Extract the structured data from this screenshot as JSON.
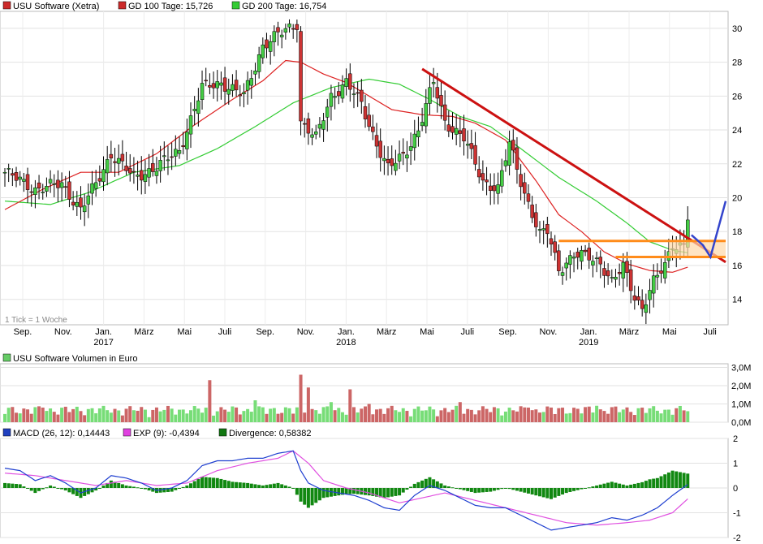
{
  "price_legend": [
    {
      "label": "USU Software (Xetra)",
      "color": "#cc2a2a"
    },
    {
      "label": "GD 100 Tage: 15,726",
      "color": "#cc2a2a"
    },
    {
      "label": "GD 200 Tage: 16,754",
      "color": "#33cc33"
    }
  ],
  "tick_note": "1 Tick = 1 Woche",
  "volume_legend": {
    "label": "USU Software Volumen in Euro",
    "color": "#66cc66"
  },
  "macd_legend": [
    {
      "label": "MACD (26, 12): 0,14443",
      "color": "#1f3fbf"
    },
    {
      "label": "EXP (9): -0,4394",
      "color": "#e040e0"
    },
    {
      "label": "Divergence: 0,58382",
      "color": "#117711"
    }
  ],
  "colors": {
    "up": "#44cc44",
    "down": "#cc3333",
    "ma100": "#dd2222",
    "ma200": "#33cc33",
    "trend": "#cc1111",
    "support": "#ff8c1a",
    "macd": "#2040d0",
    "signal": "#e050e0",
    "hist": "#118811",
    "volup": "#77dd77",
    "voldown": "#cc6666"
  },
  "chart_data": [
    {
      "type": "candlestick",
      "title": "USU Software (Xetra)",
      "y_ticks": [
        "14",
        "16",
        "18",
        "20",
        "22",
        "24",
        "26",
        "28",
        "30"
      ],
      "ylim": [
        12.5,
        31
      ],
      "x_ticks": [
        {
          "label": "Sep.",
          "year": ""
        },
        {
          "label": "Nov.",
          "year": ""
        },
        {
          "label": "Jan.",
          "year": "2017"
        },
        {
          "label": "März",
          "year": ""
        },
        {
          "label": "Mai",
          "year": ""
        },
        {
          "label": "Juli",
          "year": ""
        },
        {
          "label": "Sep.",
          "year": ""
        },
        {
          "label": "Nov.",
          "year": ""
        },
        {
          "label": "Jan.",
          "year": "2018"
        },
        {
          "label": "März",
          "year": ""
        },
        {
          "label": "Mai",
          "year": ""
        },
        {
          "label": "Juli",
          "year": ""
        },
        {
          "label": "Sep.",
          "year": ""
        },
        {
          "label": "Nov.",
          "year": ""
        },
        {
          "label": "Jan.",
          "year": "2019"
        },
        {
          "label": "März",
          "year": ""
        },
        {
          "label": "Mai",
          "year": ""
        },
        {
          "label": "Juli",
          "year": ""
        }
      ],
      "close_anchors": [
        [
          0,
          21.5
        ],
        [
          8,
          20.5
        ],
        [
          15,
          20.8
        ],
        [
          20,
          19.3
        ],
        [
          24,
          20.8
        ],
        [
          28,
          22.6
        ],
        [
          34,
          21.2
        ],
        [
          40,
          21.8
        ],
        [
          46,
          22.8
        ],
        [
          52,
          26.5
        ],
        [
          57,
          26.8
        ],
        [
          63,
          26.0
        ],
        [
          68,
          29.0
        ],
        [
          72,
          29.6
        ],
        [
          77,
          30.3
        ],
        [
          78,
          24.5
        ],
        [
          82,
          23.5
        ],
        [
          86,
          26.0
        ],
        [
          90,
          26.8
        ],
        [
          94,
          25.5
        ],
        [
          98,
          23.2
        ],
        [
          101,
          21.7
        ],
        [
          105,
          22.5
        ],
        [
          109,
          24.0
        ],
        [
          113,
          26.8
        ],
        [
          116,
          24.5
        ],
        [
          121,
          23.5
        ],
        [
          126,
          21.0
        ],
        [
          130,
          20.5
        ],
        [
          133,
          23.2
        ],
        [
          137,
          20.3
        ],
        [
          141,
          17.8
        ],
        [
          143,
          18.0
        ],
        [
          146,
          15.8
        ],
        [
          150,
          16.6
        ],
        [
          154,
          16.5
        ],
        [
          157,
          16.2
        ],
        [
          160,
          15.0
        ],
        [
          163,
          15.9
        ],
        [
          166,
          14.2
        ],
        [
          168,
          13.5
        ],
        [
          171,
          15.0
        ],
        [
          174,
          16.0
        ],
        [
          176,
          17.3
        ],
        [
          179,
          17.2
        ],
        [
          180,
          18.9
        ]
      ],
      "ma100_anchors": [
        [
          0,
          19.3
        ],
        [
          10,
          20.5
        ],
        [
          20,
          21.5
        ],
        [
          30,
          21.5
        ],
        [
          40,
          22.6
        ],
        [
          50,
          24.3
        ],
        [
          60,
          25.8
        ],
        [
          68,
          26.9
        ],
        [
          74,
          28.1
        ],
        [
          78,
          28.0
        ],
        [
          84,
          27.3
        ],
        [
          90,
          26.8
        ],
        [
          96,
          26.0
        ],
        [
          102,
          25.2
        ],
        [
          110,
          24.9
        ],
        [
          118,
          24.8
        ],
        [
          124,
          24.4
        ],
        [
          132,
          23.4
        ],
        [
          140,
          21.0
        ],
        [
          146,
          19.0
        ],
        [
          152,
          18.0
        ],
        [
          158,
          16.8
        ],
        [
          164,
          16.1
        ],
        [
          170,
          15.7
        ],
        [
          176,
          15.6
        ],
        [
          180,
          15.9
        ]
      ],
      "ma200_anchors": [
        [
          0,
          19.8
        ],
        [
          12,
          19.6
        ],
        [
          22,
          20.3
        ],
        [
          34,
          21.5
        ],
        [
          46,
          21.9
        ],
        [
          56,
          22.9
        ],
        [
          66,
          24.2
        ],
        [
          76,
          25.6
        ],
        [
          86,
          26.5
        ],
        [
          96,
          27.0
        ],
        [
          104,
          26.7
        ],
        [
          112,
          25.8
        ],
        [
          120,
          24.8
        ],
        [
          128,
          24.2
        ],
        [
          136,
          22.9
        ],
        [
          146,
          21.2
        ],
        [
          156,
          19.8
        ],
        [
          164,
          18.5
        ],
        [
          170,
          17.4
        ],
        [
          176,
          16.9
        ],
        [
          180,
          16.75
        ]
      ],
      "trendline": [
        [
          110,
          27.6
        ],
        [
          190,
          16.2
        ]
      ],
      "resistance_lines": [
        [
          146,
          17.45,
          190,
          17.45
        ],
        [
          161,
          16.5,
          190,
          16.5
        ]
      ],
      "projection": [
        [
          181,
          17.8
        ],
        [
          184,
          17.2
        ],
        [
          186,
          16.5
        ],
        [
          190,
          19.8
        ]
      ]
    },
    {
      "type": "bar",
      "title": "USU Software Volumen in Euro",
      "y_ticks": [
        "0,0M",
        "1,0M",
        "2,0M",
        "3,0M"
      ],
      "ylim": [
        0,
        3.2
      ],
      "spikes": [
        [
          54,
          2.3
        ],
        [
          78,
          2.6
        ],
        [
          80,
          1.9
        ],
        [
          86,
          1.1
        ],
        [
          91,
          1.8
        ],
        [
          96,
          1.0
        ],
        [
          66,
          1.2
        ],
        [
          120,
          1.1
        ],
        [
          156,
          0.9
        ],
        [
          138,
          0.8
        ],
        [
          10,
          0.8
        ]
      ]
    },
    {
      "type": "line",
      "title": "MACD (26, 12)",
      "y_ticks": [
        "-2",
        "-1",
        "0",
        "1",
        "2"
      ],
      "ylim": [
        -2,
        2
      ],
      "macd_anchors": [
        [
          0,
          0.8
        ],
        [
          4,
          0.7
        ],
        [
          8,
          0.3
        ],
        [
          12,
          0.5
        ],
        [
          16,
          0.2
        ],
        [
          20,
          -0.2
        ],
        [
          24,
          0.0
        ],
        [
          28,
          0.5
        ],
        [
          32,
          0.4
        ],
        [
          36,
          0.2
        ],
        [
          40,
          -0.1
        ],
        [
          44,
          0.0
        ],
        [
          48,
          0.3
        ],
        [
          52,
          0.9
        ],
        [
          56,
          1.1
        ],
        [
          60,
          1.1
        ],
        [
          64,
          1.2
        ],
        [
          68,
          1.2
        ],
        [
          72,
          1.4
        ],
        [
          76,
          1.5
        ],
        [
          78,
          0.7
        ],
        [
          80,
          0.2
        ],
        [
          84,
          -0.1
        ],
        [
          88,
          -0.2
        ],
        [
          92,
          -0.3
        ],
        [
          96,
          -0.5
        ],
        [
          100,
          -0.8
        ],
        [
          104,
          -0.9
        ],
        [
          108,
          -0.3
        ],
        [
          112,
          0.1
        ],
        [
          116,
          -0.1
        ],
        [
          120,
          -0.4
        ],
        [
          124,
          -0.7
        ],
        [
          128,
          -0.8
        ],
        [
          132,
          -0.8
        ],
        [
          136,
          -1.1
        ],
        [
          140,
          -1.4
        ],
        [
          144,
          -1.7
        ],
        [
          148,
          -1.6
        ],
        [
          152,
          -1.5
        ],
        [
          156,
          -1.4
        ],
        [
          160,
          -1.2
        ],
        [
          164,
          -1.3
        ],
        [
          168,
          -1.1
        ],
        [
          172,
          -0.8
        ],
        [
          176,
          -0.3
        ],
        [
          180,
          0.14
        ]
      ],
      "signal_anchors": [
        [
          0,
          0.6
        ],
        [
          8,
          0.5
        ],
        [
          16,
          0.3
        ],
        [
          24,
          0.1
        ],
        [
          32,
          0.3
        ],
        [
          40,
          0.1
        ],
        [
          48,
          0.2
        ],
        [
          56,
          0.7
        ],
        [
          64,
          1.0
        ],
        [
          72,
          1.2
        ],
        [
          76,
          1.5
        ],
        [
          80,
          1.0
        ],
        [
          84,
          0.3
        ],
        [
          90,
          0.0
        ],
        [
          96,
          -0.2
        ],
        [
          104,
          -0.6
        ],
        [
          110,
          -0.4
        ],
        [
          116,
          -0.2
        ],
        [
          124,
          -0.5
        ],
        [
          132,
          -0.8
        ],
        [
          140,
          -1.1
        ],
        [
          148,
          -1.4
        ],
        [
          156,
          -1.5
        ],
        [
          164,
          -1.4
        ],
        [
          170,
          -1.3
        ],
        [
          176,
          -1.0
        ],
        [
          180,
          -0.44
        ]
      ]
    }
  ]
}
